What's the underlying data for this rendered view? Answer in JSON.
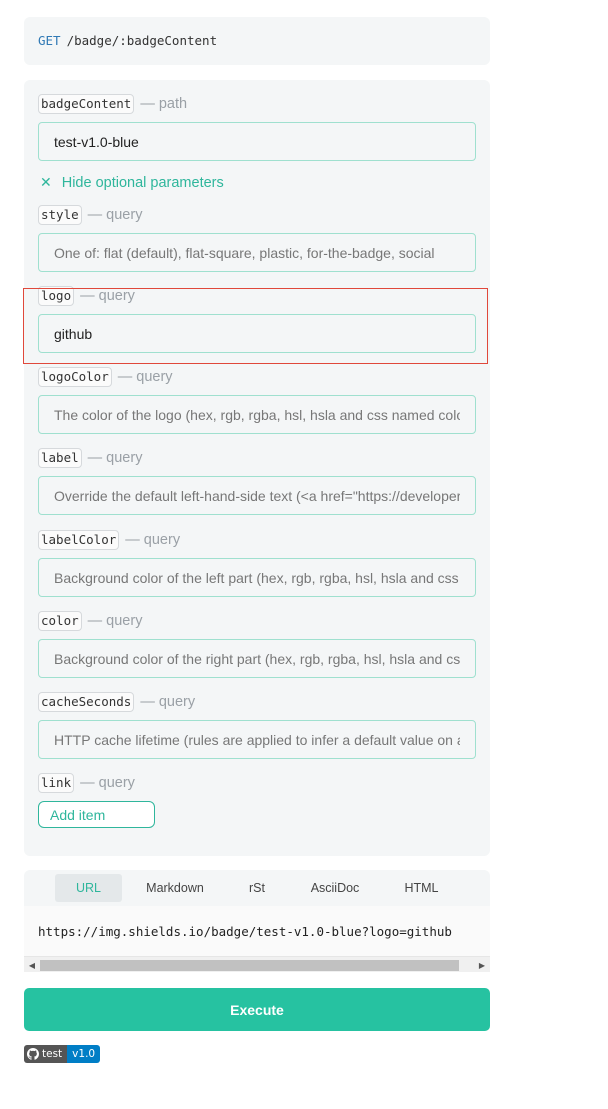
{
  "endpoint": {
    "method": "GET",
    "path": "/badge/:badgeContent"
  },
  "params": {
    "badgeContent": {
      "name": "badgeContent",
      "kind": "— path",
      "value": "test-v1.0-blue"
    },
    "toggle_label": "Hide optional parameters",
    "style": {
      "name": "style",
      "kind": "— query",
      "placeholder": "One of: flat (default), flat-square, plastic, for-the-badge, social"
    },
    "logo": {
      "name": "logo",
      "kind": "— query",
      "value": "github"
    },
    "logoColor": {
      "name": "logoColor",
      "kind": "— query",
      "placeholder": "The color of the logo (hex, rgb, rgba, hsl, hsla and css named colors supported)"
    },
    "label": {
      "name": "label",
      "kind": "— query",
      "placeholder": "Override the default left-hand-side text (<a href=\"https://developer.mozilla.org\">)"
    },
    "labelColor": {
      "name": "labelColor",
      "kind": "— query",
      "placeholder": "Background color of the left part (hex, rgb, rgba, hsl, hsla and css named colors)"
    },
    "color": {
      "name": "color",
      "kind": "— query",
      "placeholder": "Background color of the right part (hex, rgb, rgba, hsl, hsla and css named colors)"
    },
    "cacheSeconds": {
      "name": "cacheSeconds",
      "kind": "— query",
      "placeholder": "HTTP cache lifetime (rules are applied to infer a default value on a per-badge basis)"
    },
    "link": {
      "name": "link",
      "kind": "— query",
      "add_label": "Add item"
    }
  },
  "snippet": {
    "tabs": [
      "URL",
      "Markdown",
      "rSt",
      "AsciiDoc",
      "HTML"
    ],
    "active_tab": "URL",
    "url": "https://img.shields.io/badge/test-v1.0-blue?logo=github"
  },
  "execute_label": "Execute",
  "badge": {
    "label": "test",
    "message": "v1.0",
    "label_color": "#555555",
    "message_color": "#007ec6",
    "logo": "github-icon"
  },
  "colors": {
    "accent": "#26c2a1",
    "highlight": "#e0483b",
    "method": "#3079b5"
  }
}
